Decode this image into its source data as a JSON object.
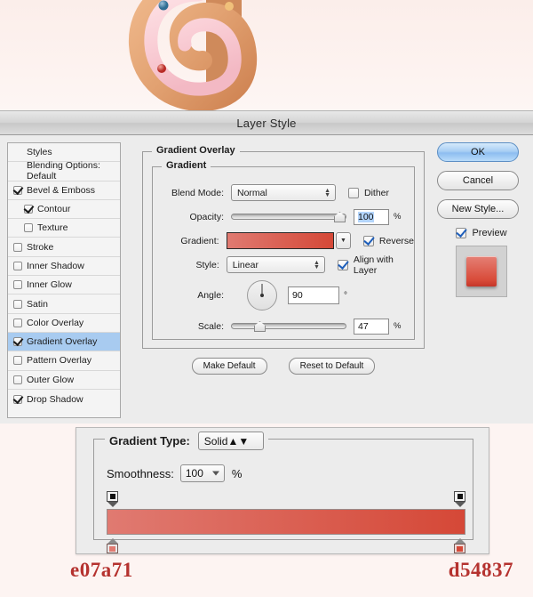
{
  "artwork": {
    "description": "Iced cookie letter Q illustration with pink glaze and candy beads"
  },
  "dialog": {
    "title": "Layer Style",
    "sidebar": [
      {
        "label": "Styles",
        "checkbox": "none",
        "checked": false,
        "indent": false,
        "selected": false
      },
      {
        "label": "Blending Options: Default",
        "checkbox": "none",
        "checked": false,
        "indent": false,
        "selected": false
      },
      {
        "label": "Bevel & Emboss",
        "checkbox": "yes",
        "checked": true,
        "indent": false,
        "selected": false
      },
      {
        "label": "Contour",
        "checkbox": "yes",
        "checked": true,
        "indent": true,
        "selected": false
      },
      {
        "label": "Texture",
        "checkbox": "yes",
        "checked": false,
        "indent": true,
        "selected": false
      },
      {
        "label": "Stroke",
        "checkbox": "yes",
        "checked": false,
        "indent": false,
        "selected": false
      },
      {
        "label": "Inner Shadow",
        "checkbox": "yes",
        "checked": false,
        "indent": false,
        "selected": false
      },
      {
        "label": "Inner Glow",
        "checkbox": "yes",
        "checked": false,
        "indent": false,
        "selected": false
      },
      {
        "label": "Satin",
        "checkbox": "yes",
        "checked": false,
        "indent": false,
        "selected": false
      },
      {
        "label": "Color Overlay",
        "checkbox": "yes",
        "checked": false,
        "indent": false,
        "selected": false
      },
      {
        "label": "Gradient Overlay",
        "checkbox": "yes",
        "checked": true,
        "indent": false,
        "selected": true
      },
      {
        "label": "Pattern Overlay",
        "checkbox": "yes",
        "checked": false,
        "indent": false,
        "selected": false
      },
      {
        "label": "Outer Glow",
        "checkbox": "yes",
        "checked": false,
        "indent": false,
        "selected": false
      },
      {
        "label": "Drop Shadow",
        "checkbox": "yes",
        "checked": true,
        "indent": false,
        "selected": false
      }
    ],
    "panel": {
      "outer_legend": "Gradient Overlay",
      "inner_legend": "Gradient",
      "blend_mode_label": "Blend Mode:",
      "blend_mode_value": "Normal",
      "dither_label": "Dither",
      "dither_checked": false,
      "opacity_label": "Opacity:",
      "opacity_value": "100",
      "opacity_unit": "%",
      "opacity_pct": 100,
      "gradient_label": "Gradient:",
      "reverse_label": "Reverse",
      "reverse_checked": true,
      "style_label": "Style:",
      "style_value": "Linear",
      "align_label": "Align with Layer",
      "align_checked": true,
      "angle_label": "Angle:",
      "angle_value": "90",
      "angle_unit": "°",
      "scale_label": "Scale:",
      "scale_value": "47",
      "scale_unit": "%",
      "scale_pct": 22,
      "make_default": "Make Default",
      "reset_default": "Reset to Default"
    },
    "buttons": {
      "ok": "OK",
      "cancel": "Cancel",
      "new_style": "New Style...",
      "preview_label": "Preview",
      "preview_checked": true
    }
  },
  "gradient_editor": {
    "type_label": "Gradient Type:",
    "type_value": "Solid",
    "smoothness_label": "Smoothness:",
    "smoothness_value": "100",
    "smoothness_unit": "%",
    "stops": {
      "opacity_left": "100%",
      "opacity_right": "100%",
      "color_left": "e07a71",
      "color_right": "d54837"
    }
  },
  "hex_labels": {
    "left": "e07a71",
    "right": "d54837"
  },
  "colors": {
    "gradient_start": "#e07a71",
    "gradient_end": "#d54837",
    "selection_blue": "#a8cbf0",
    "hex_text": "#b5322f"
  }
}
